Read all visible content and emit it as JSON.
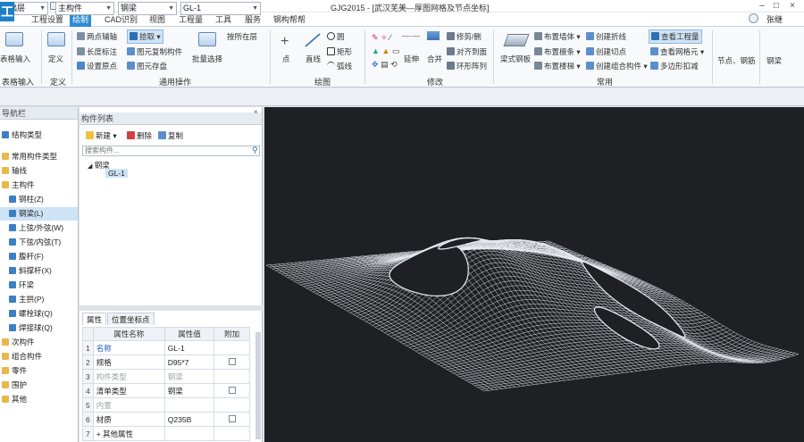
{
  "app": {
    "logo_glyph": "工",
    "window_title": "GJG2015 - [武汉芜美—厚图网格及节点坐标]",
    "user_name": "张继",
    "window_controls": [
      "–",
      "□",
      "×"
    ]
  },
  "menu": {
    "tabs": [
      "工程设置",
      "绘制",
      "CAD识别",
      "视图",
      "工程量",
      "工具",
      "服务",
      "钢构帮帮"
    ],
    "active_tab": "绘制"
  },
  "ribbon": {
    "groups": [
      {
        "label": "表格输入",
        "buttons": [
          "表格输入"
        ]
      },
      {
        "label": "定义",
        "buttons": [
          "定义"
        ]
      },
      {
        "label": "通用操作",
        "buttons": [
          "两点辅轴",
          "平行辅轴",
          "长度标注",
          "设置原点",
          "拾取",
          "图元存盘",
          "图元复制构件",
          "批量选择",
          "按所在层"
        ]
      },
      {
        "label": "绘图",
        "buttons": [
          "点",
          "直线",
          "圆",
          "矩形",
          "弧线"
        ]
      },
      {
        "label": "修改",
        "buttons": [
          "延伸",
          "合并",
          "修剪/删",
          "对齐到面",
          "环形阵列"
        ]
      },
      {
        "label": "常用",
        "buttons": [
          "梁式钢板",
          "布置墙体",
          "布置檩条",
          "布置楼梯",
          "创建折线",
          "创建组合构件",
          "创建切点",
          "修剪檩条",
          "查看工程量",
          "查看网格元",
          "多边形扣减"
        ]
      },
      {
        "label": "",
        "buttons": [
          "节点、钢筋",
          "钢梁"
        ]
      }
    ],
    "selected_button": "拾取",
    "right_selected": "查看工程量"
  },
  "combobar": {
    "floor": "基础层",
    "category": "主构件",
    "type": "钢梁",
    "component": "GL-1"
  },
  "navigator": {
    "title": "导航栏",
    "items": [
      {
        "label": "结构类型",
        "indent": 0,
        "kind": "comp"
      },
      {
        "label": "常用构件类型",
        "indent": 0,
        "kind": "folder"
      },
      {
        "label": "轴线",
        "indent": 0,
        "kind": "folder"
      },
      {
        "label": "主构件",
        "indent": 0,
        "kind": "folder"
      },
      {
        "label": "钢柱(Z)",
        "indent": 1,
        "kind": "comp"
      },
      {
        "label": "钢梁(L)",
        "indent": 1,
        "kind": "comp",
        "selected": true
      },
      {
        "label": "上弦/外弦(W)",
        "indent": 1,
        "kind": "comp"
      },
      {
        "label": "下弦/内弦(T)",
        "indent": 1,
        "kind": "comp"
      },
      {
        "label": "腹杆(F)",
        "indent": 1,
        "kind": "comp"
      },
      {
        "label": "斜撑杆(X)",
        "indent": 1,
        "kind": "comp"
      },
      {
        "label": "环梁",
        "indent": 1,
        "kind": "comp"
      },
      {
        "label": "主拱(P)",
        "indent": 1,
        "kind": "comp"
      },
      {
        "label": "螺栓球(Q)",
        "indent": 1,
        "kind": "comp"
      },
      {
        "label": "焊接球(Q)",
        "indent": 1,
        "kind": "comp"
      },
      {
        "label": "次构件",
        "indent": 0,
        "kind": "folder"
      },
      {
        "label": "组合构件",
        "indent": 0,
        "kind": "folder"
      },
      {
        "label": "零件",
        "indent": 0,
        "kind": "folder"
      },
      {
        "label": "围护",
        "indent": 0,
        "kind": "folder"
      },
      {
        "label": "其他",
        "indent": 0,
        "kind": "folder"
      }
    ]
  },
  "component_list": {
    "title": "构件列表",
    "new_label": "新建",
    "delete_label": "删除",
    "copy_label": "复制",
    "search_placeholder": "搜索构件...",
    "tree_root": "钢梁",
    "tree_child": "GL-1"
  },
  "properties": {
    "tabs": [
      "属性",
      "位置坐标点"
    ],
    "headers": [
      "属性名称",
      "属性值",
      "附加"
    ],
    "rows": [
      {
        "num": "1",
        "name": "名称",
        "value": "GL-1",
        "checkbox": false,
        "name_style": "blue"
      },
      {
        "num": "2",
        "name": "规格",
        "value": "D95*7",
        "checkbox": true,
        "name_style": ""
      },
      {
        "num": "3",
        "name": "构件类型",
        "value": "钢梁",
        "checkbox": false,
        "name_style": "muted"
      },
      {
        "num": "4",
        "name": "清单类型",
        "value": "钢梁",
        "checkbox": true,
        "name_style": ""
      },
      {
        "num": "5",
        "name": "内置",
        "value": "",
        "checkbox": false,
        "name_style": "muted"
      },
      {
        "num": "6",
        "name": "材质",
        "value": "Q235B",
        "checkbox": true,
        "name_style": ""
      },
      {
        "num": "7",
        "name": "+ 其他属性",
        "value": "",
        "checkbox": false,
        "name_style": ""
      }
    ]
  },
  "colors": {
    "accent": "#2d8ad3",
    "viewport_bg": "#1e2023",
    "mesh": "#e9edf2"
  }
}
